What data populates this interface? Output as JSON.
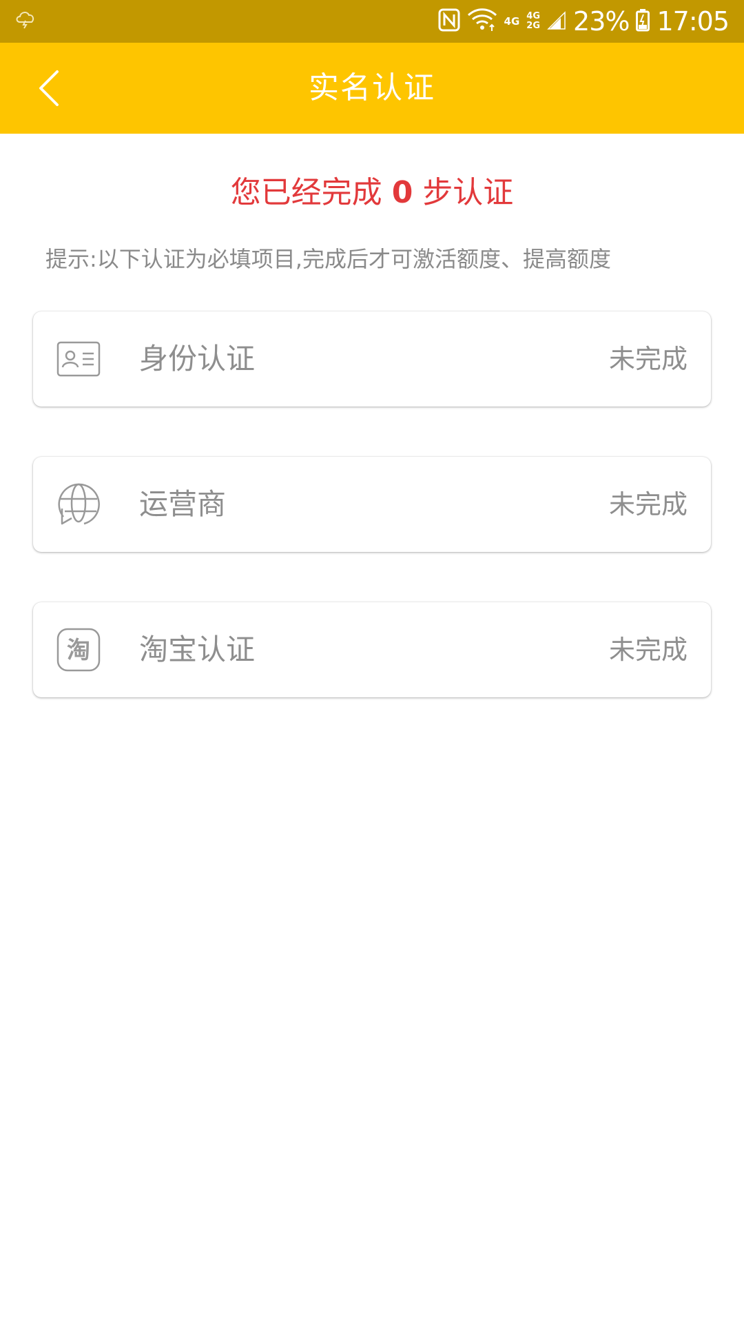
{
  "status_bar": {
    "weather_icon": "cloud-lightning-icon",
    "nfc_icon": "nfc-icon",
    "wifi_icon": "wifi-icon",
    "network_4g": "4G",
    "network_4g_top": "4G",
    "network_2g_bottom": "2G",
    "signal_icon": "signal-icon",
    "battery_percent": "23%",
    "battery_icon": "battery-charging-icon",
    "time": "17:05",
    "background_color": "#c29800"
  },
  "header": {
    "back_icon": "chevron-left-icon",
    "title": "实名认证",
    "background_color": "#fec500"
  },
  "progress": {
    "prefix": "您已经完成",
    "count": "0",
    "suffix": "步认证",
    "color": "#e2393b"
  },
  "tip": "提示:以下认证为必填项目,完成后才可激活额度、提高额度",
  "items": [
    {
      "icon": "id-card-icon",
      "label": "身份认证",
      "status": "未完成"
    },
    {
      "icon": "operator-globe-icon",
      "label": "运营商",
      "status": "未完成"
    },
    {
      "icon": "taobao-icon",
      "label": "淘宝认证",
      "status": "未完成"
    }
  ]
}
